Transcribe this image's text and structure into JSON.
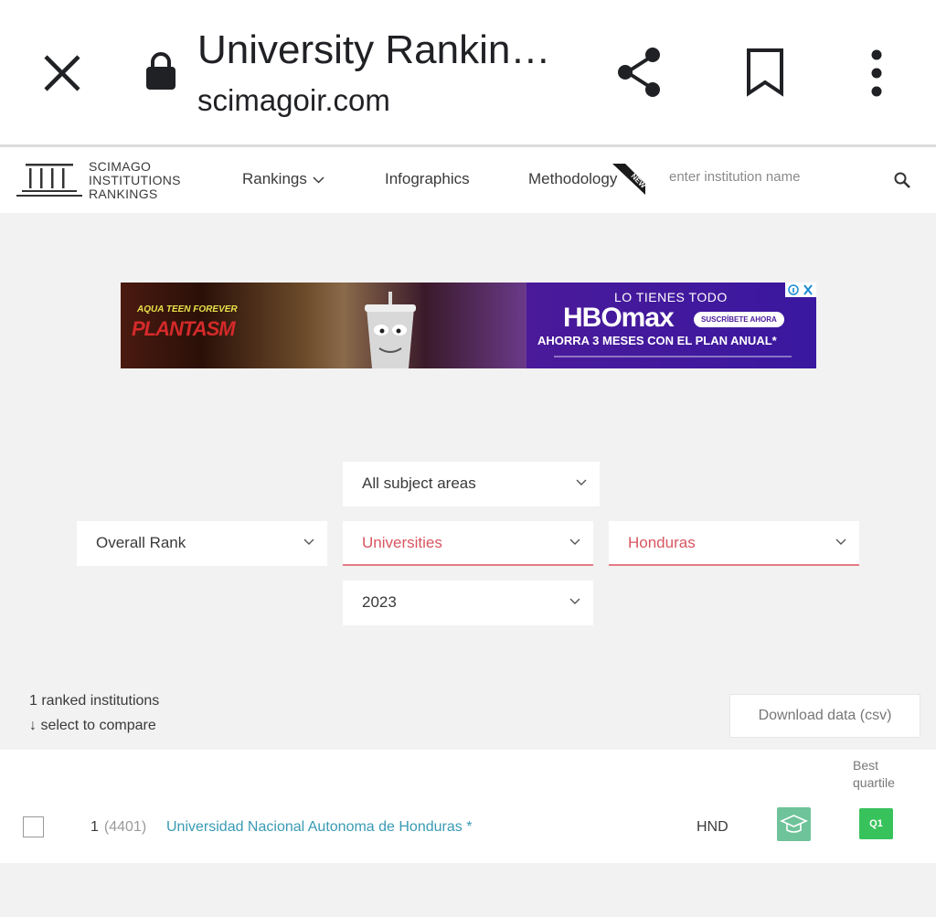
{
  "browser": {
    "title": "University Rankin…",
    "url": "scimagoir.com"
  },
  "header": {
    "logo_lines": [
      "SCIMAGO",
      "INSTITUTIONS",
      "RANKINGS"
    ],
    "nav": {
      "rankings": "Rankings",
      "infographics": "Infographics",
      "methodology": "Methodology",
      "new_badge": "NEW"
    },
    "search_placeholder": "enter institution name"
  },
  "ad": {
    "show_line1": "AQUA TEEN FOREVER",
    "show_line2": "PLANTASM",
    "tagline": "LO TIENES TODO",
    "brand": "HBOmax",
    "cta": "SUSCRÍBETE AHORA",
    "offer": "AHORRA 3 MESES CON EL PLAN ANUAL*"
  },
  "filters": {
    "subject": "All subject areas",
    "rank_type": "Overall Rank",
    "sector": "Universities",
    "country": "Honduras",
    "year": "2023"
  },
  "results": {
    "count_text": "1 ranked institutions",
    "compare_text": "↓ select to compare",
    "download_label": "Download data (csv)"
  },
  "table": {
    "best_quartile_header": [
      "Best",
      "quartile"
    ],
    "rows": [
      {
        "rank": "1",
        "world_rank": "(4401)",
        "name": "Universidad Nacional Autonoma de Honduras *",
        "country_code": "HND",
        "sector_icon": "graduation-cap-icon",
        "quartile": "Q1"
      }
    ]
  },
  "colors": {
    "accent_red": "#d95560",
    "link_blue": "#3a9ab4",
    "sector_green": "#6fc39a",
    "quartile_green": "#38c25c"
  }
}
